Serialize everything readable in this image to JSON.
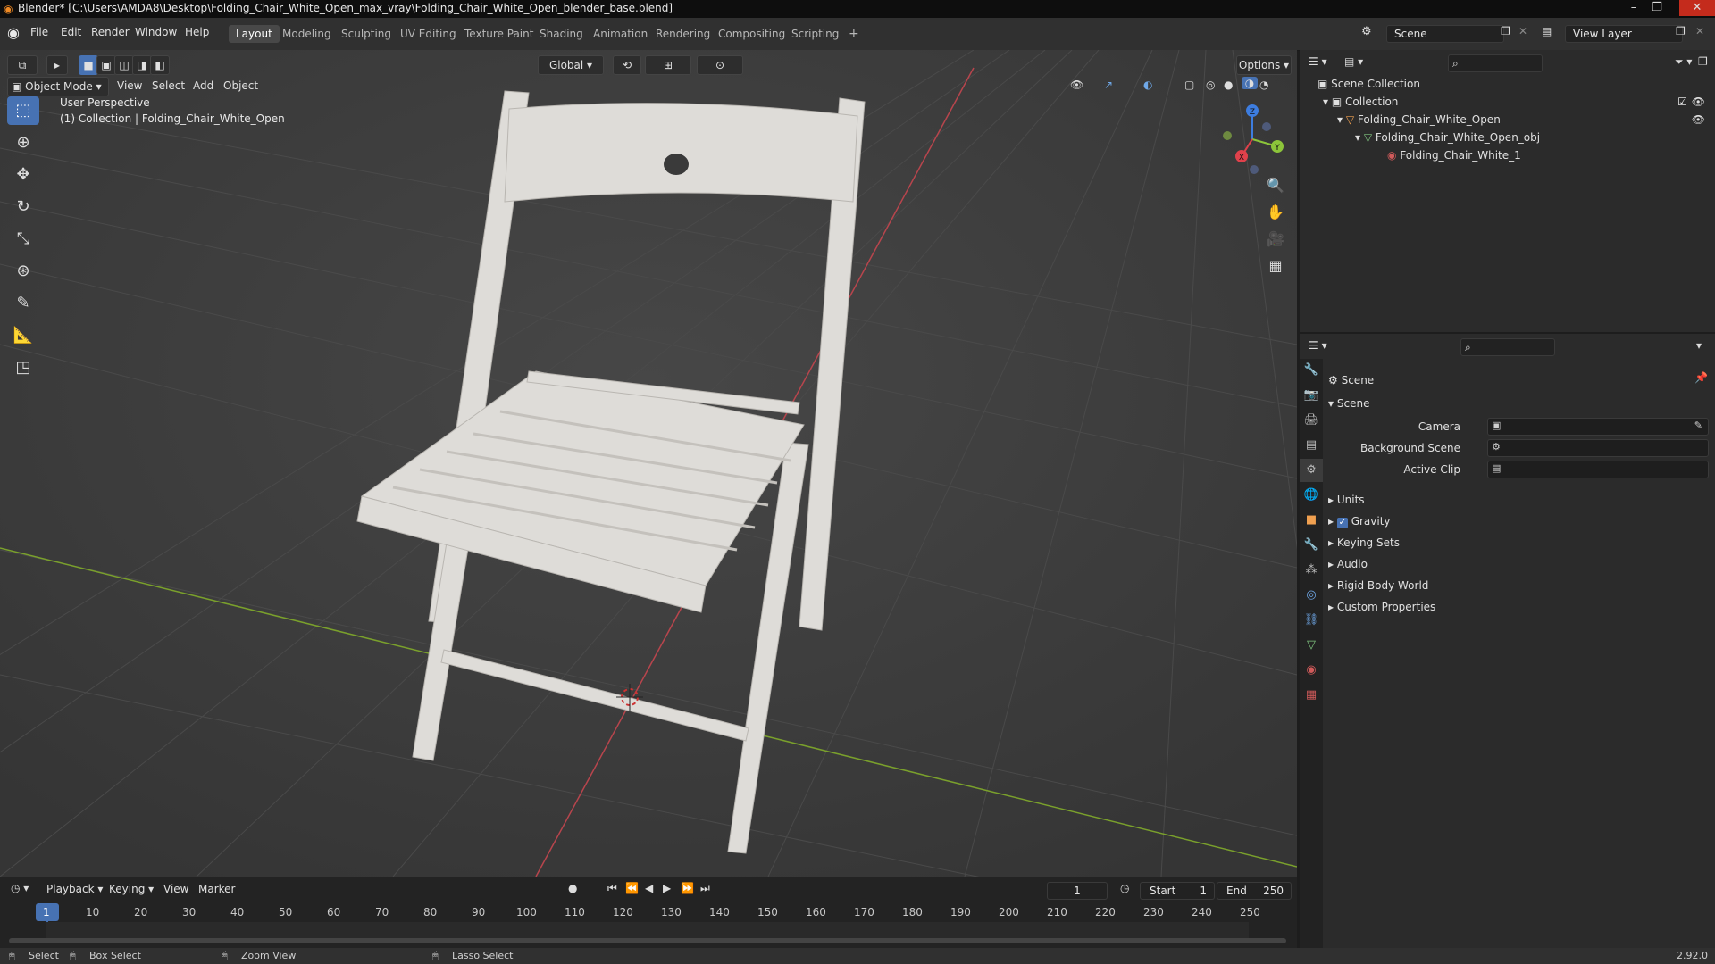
{
  "titlebar": {
    "title": "Blender* [C:\\Users\\AMDA8\\Desktop\\Folding_Chair_White_Open_max_vray\\Folding_Chair_White_Open_blender_base.blend]",
    "minimize": "–",
    "maximize": "❐",
    "close": "✕"
  },
  "menu": {
    "file": "File",
    "edit": "Edit",
    "render": "Render",
    "window": "Window",
    "help": "Help"
  },
  "workspaces": [
    "Layout",
    "Modeling",
    "Sculpting",
    "UV Editing",
    "Texture Paint",
    "Shading",
    "Animation",
    "Rendering",
    "Compositing",
    "Scripting"
  ],
  "workspace_add": "+",
  "scene_selector": {
    "scene": "Scene",
    "view_layer": "View Layer"
  },
  "viewport": {
    "mode": "Object Mode",
    "menus": [
      "View",
      "Select",
      "Add",
      "Object"
    ],
    "transform_orientation": "Global",
    "options": "Options",
    "overlay_text_1": "User Perspective",
    "overlay_text_2": "(1) Collection | Folding_Chair_White_Open",
    "gizmo": {
      "x": "X",
      "y": "Y",
      "z": "Z"
    }
  },
  "timeline": {
    "menus": [
      "Playback",
      "Keying",
      "View",
      "Marker"
    ],
    "current_frame": "1",
    "start_label": "Start",
    "start": "1",
    "end_label": "End",
    "end": "250",
    "ticks": [
      "1",
      "10",
      "20",
      "30",
      "40",
      "50",
      "60",
      "70",
      "80",
      "90",
      "100",
      "110",
      "120",
      "130",
      "140",
      "150",
      "160",
      "170",
      "180",
      "190",
      "200",
      "210",
      "220",
      "230",
      "240",
      "250"
    ]
  },
  "outliner": {
    "scene_collection": "Scene Collection",
    "collection": "Collection",
    "object": "Folding_Chair_White_Open",
    "mesh": "Folding_Chair_White_Open_obj",
    "material": "Folding_Chair_White_1"
  },
  "properties": {
    "header": "Scene",
    "panel": "Scene",
    "camera_label": "Camera",
    "background_scene_label": "Background Scene",
    "active_clip_label": "Active Clip",
    "sections": [
      "Units",
      "Gravity",
      "Keying Sets",
      "Audio",
      "Rigid Body World",
      "Custom Properties"
    ]
  },
  "statusbar": {
    "select": "Select",
    "box_select": "Box Select",
    "zoom_view": "Zoom View",
    "lasso_select": "Lasso Select",
    "version": "2.92.0"
  },
  "colors": {
    "accent": "#4772b3",
    "grid_x_axis": "#b8454d",
    "grid_y_axis": "#7aa02c",
    "chair": "#dedcd8"
  }
}
